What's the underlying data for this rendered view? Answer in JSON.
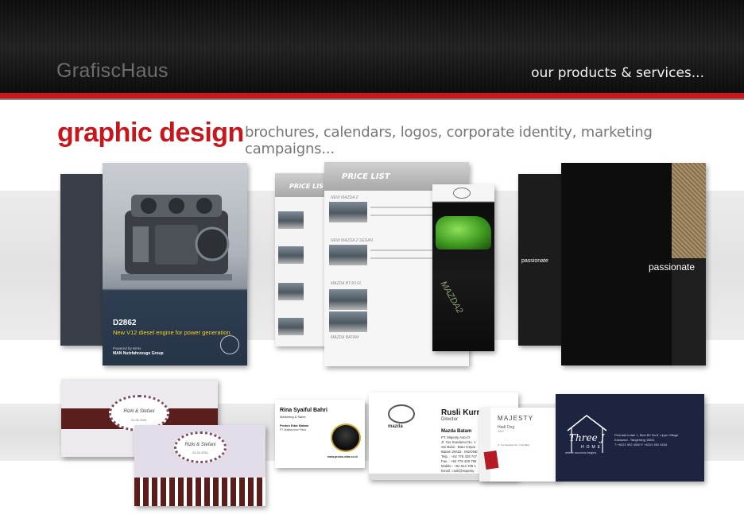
{
  "header": {
    "brand": "GrafiscHaus",
    "tagline": "our products & services..."
  },
  "section": {
    "title": "graphic design",
    "subtitle": "brochures, calendars, logos, corporate identity, marketing campaigns..."
  },
  "colors": {
    "accent": "#c8161d",
    "header_bg": "#141414",
    "brand_text": "#6d6d6d"
  },
  "brochures": {
    "man": {
      "title": "D2862",
      "description": "New V12 diesel engine for power generation.",
      "footer_label": "Powered by MAN",
      "footer_company": "MAN Nutzfahrzeuge Group",
      "logo": "MAN"
    },
    "mazda_pricelist": {
      "title": "PRICE LIST",
      "title_left": "PRICE LIS",
      "model_1": "NEW MAZDA 2",
      "model_2": "NEW MAZDA 2 SEDAN",
      "model_3": "MAZDA BT-50 FL",
      "dealer": "MAZDA BATAM",
      "strip_text": "MAZDA2",
      "logo": "mazda-logo"
    },
    "passionate": {
      "word": "passionate",
      "word_left": "passionate"
    }
  },
  "cards": {
    "wedding": {
      "names": "Rizki & Stefani",
      "date": "21.01.2011"
    },
    "proton": {
      "name": "Rina Syaiful Bahri",
      "role": "Marketing & Sales",
      "company": "Proton Edar Batam",
      "address": "PT. Majesty Auto Prima",
      "website": "www.proton-edar.co.id",
      "logo_text": "PROTON"
    },
    "mazda": {
      "name": "Rusli Kurn",
      "role": "Director",
      "company": "Mazda Batam",
      "address_1": "PT. Majesty Auto D",
      "address_2": "Jl. Yos Soedarso No. 1",
      "address_3": "Sei Baloi - Batu Ampar",
      "address_4": "Batam 29432 . INDONE",
      "phone": "Telp. : +62 778 429 747",
      "fax": "Fax. : +62 778 429 795",
      "mobile": "Mobile : +62 812 705 1",
      "email": "Email : rusli@majesty",
      "logo_text": "mazda"
    },
    "majesty": {
      "title": "MAJESTY",
      "name": "Hadi Ong",
      "role": "CEO",
      "address": "Jl. Yos Soedarso No. 1 Sei Baloi"
    },
    "threej": {
      "brand": "Three J",
      "home": "HOME",
      "slogan": "where success begins",
      "address_1": "Permata Indah 1, Blok B2 No.8, Lippo Village",
      "address_2": "Karawaci - Tangerang 15811",
      "phone": "T +6221 592 4530 F +6221 592 4534"
    }
  }
}
